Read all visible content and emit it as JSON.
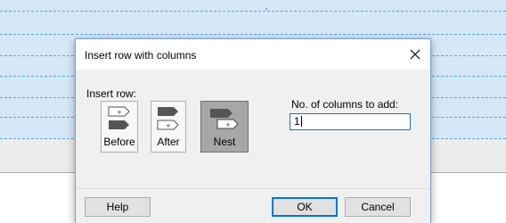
{
  "dialog": {
    "title": "Insert row with columns",
    "insert_row_label": "Insert row:",
    "options": [
      {
        "label": "Before",
        "selected": false
      },
      {
        "label": "After",
        "selected": false
      },
      {
        "label": "Nest",
        "selected": true
      }
    ],
    "columns_label": "No. of columns to add:",
    "columns_value": "1",
    "buttons": {
      "help": "Help",
      "ok": "OK",
      "cancel": "Cancel"
    }
  },
  "icons": {
    "close": "close-icon",
    "before": "insert-before-icon",
    "after": "insert-after-icon",
    "nest": "insert-nest-icon"
  },
  "colors": {
    "background_table": "#d6e8f8",
    "dashed_gridline": "#55a8dd",
    "accent": "#0078d7",
    "selected_option": "#a7a7a7"
  }
}
